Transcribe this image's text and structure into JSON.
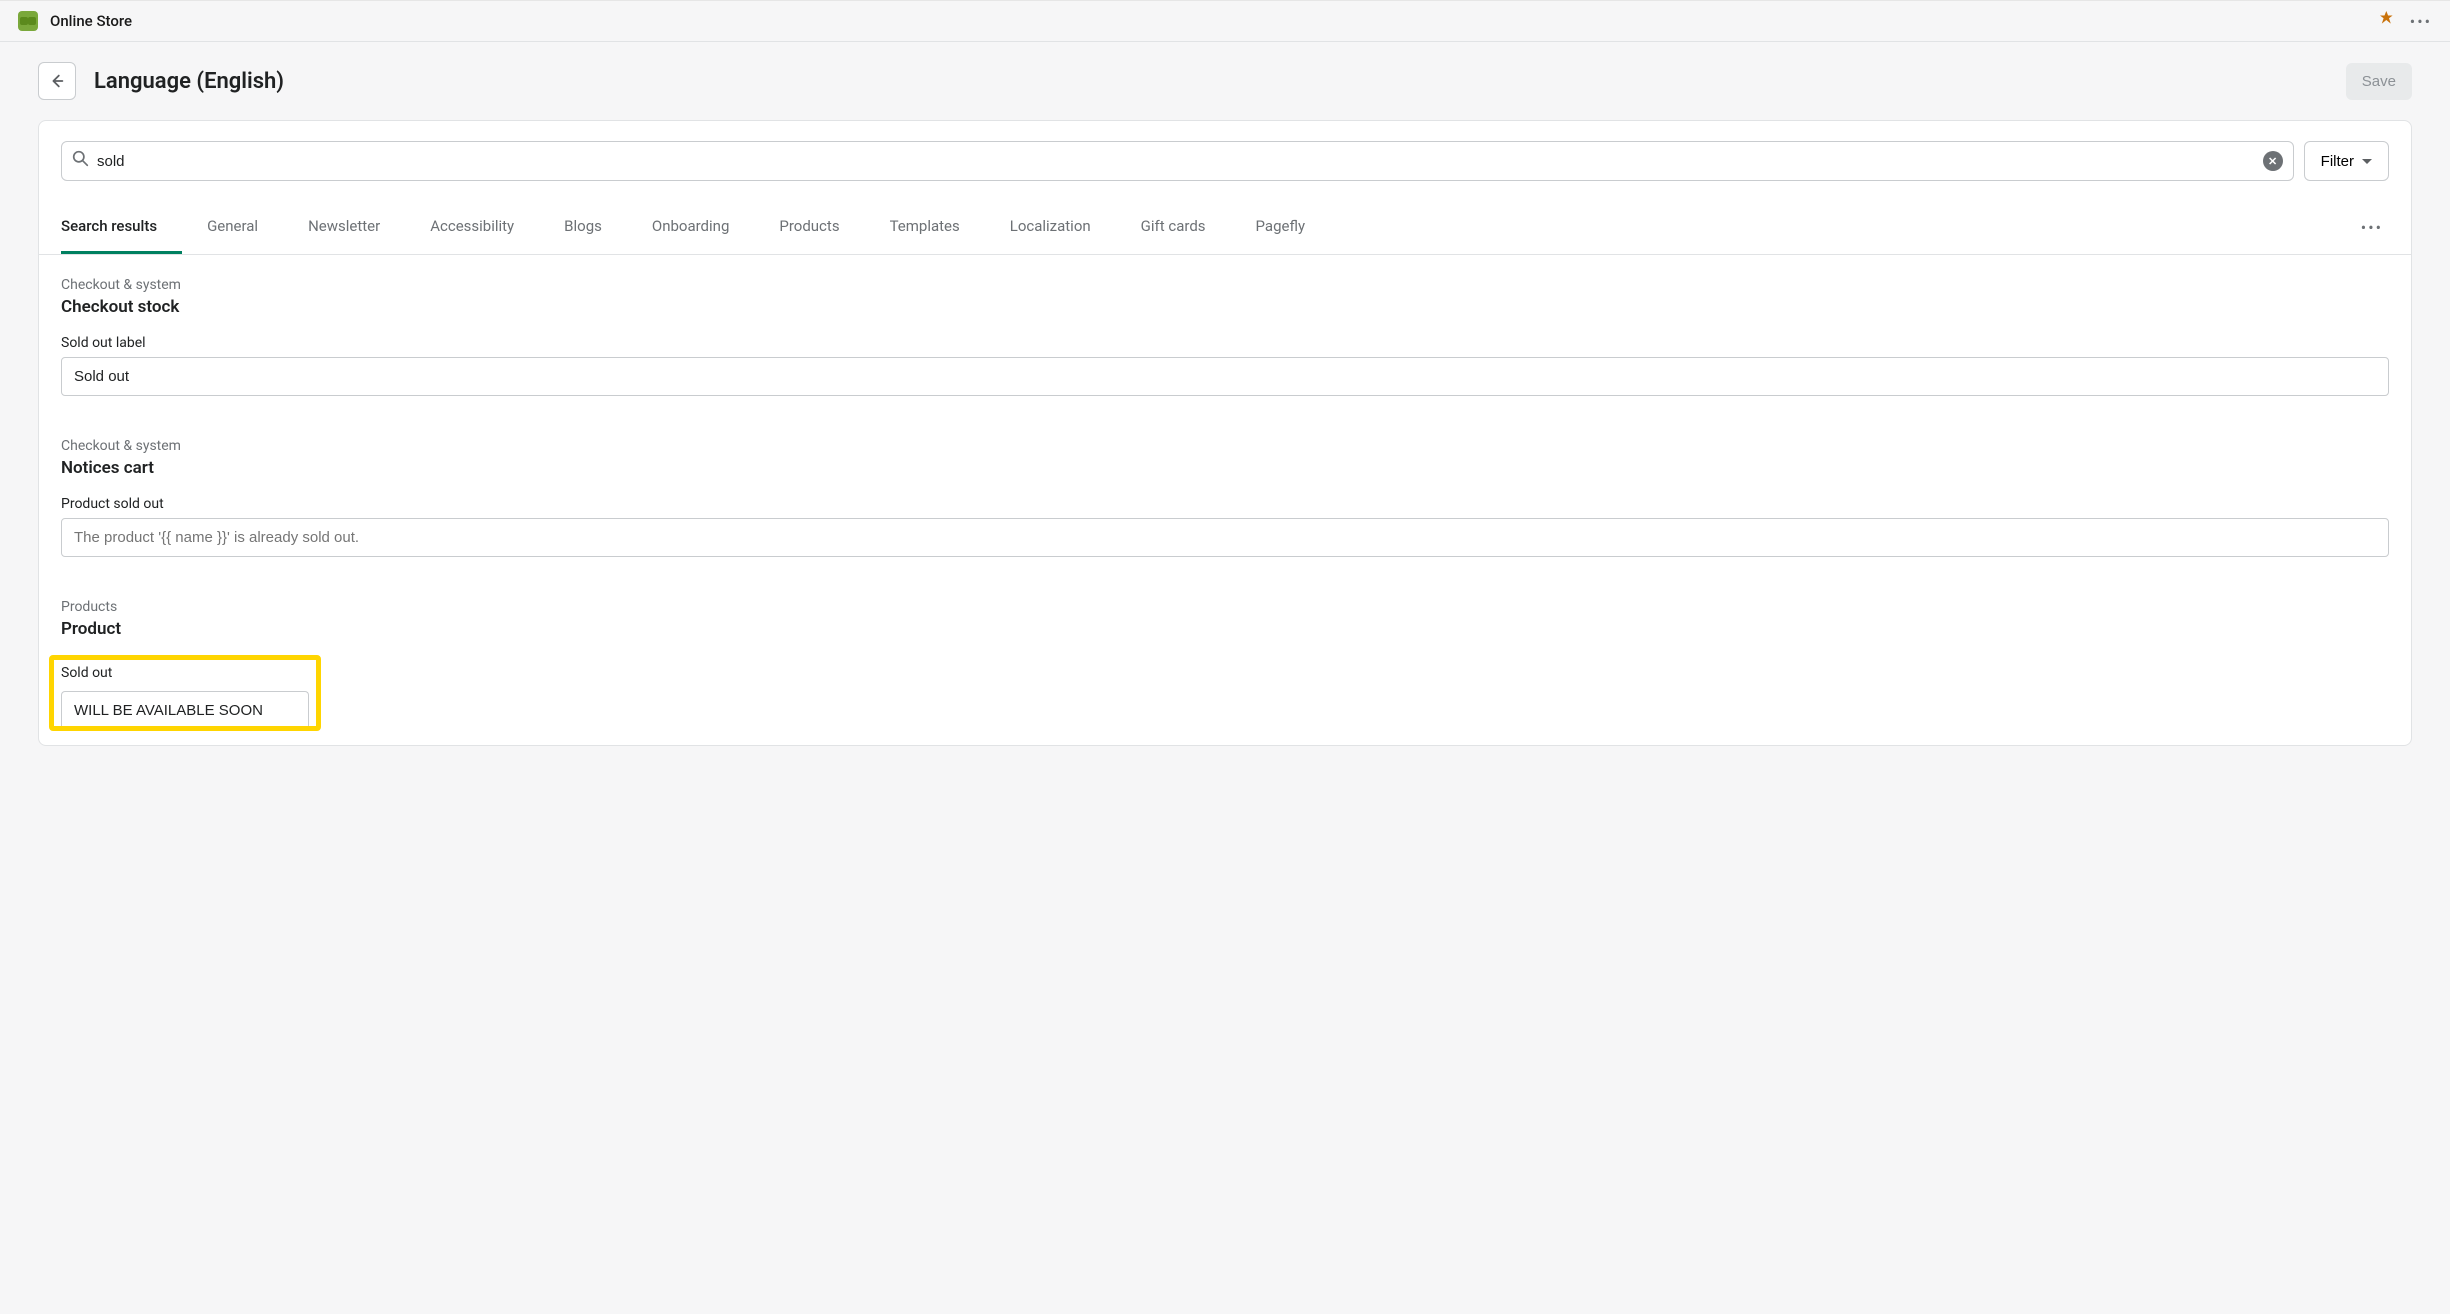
{
  "topbar": {
    "app_title": "Online Store"
  },
  "header": {
    "page_title": "Language (English)",
    "save_label": "Save"
  },
  "search": {
    "value": "sold",
    "filter_label": "Filter"
  },
  "tabs": [
    "Search results",
    "General",
    "Newsletter",
    "Accessibility",
    "Blogs",
    "Onboarding",
    "Products",
    "Templates",
    "Localization",
    "Gift cards",
    "Pagefly"
  ],
  "sections": [
    {
      "breadcrumb": "Checkout & system",
      "title": "Checkout stock",
      "field_label": "Sold out label",
      "field_value": "Sold out",
      "is_placeholder": false,
      "highlighted": false
    },
    {
      "breadcrumb": "Checkout & system",
      "title": "Notices cart",
      "field_label": "Product sold out",
      "field_value": "The product '{{ name }}' is already sold out.",
      "is_placeholder": true,
      "highlighted": false
    },
    {
      "breadcrumb": "Products",
      "title": "Product",
      "field_label": "Sold out",
      "field_value": "WILL BE AVAILABLE SOON",
      "is_placeholder": false,
      "highlighted": true
    }
  ]
}
